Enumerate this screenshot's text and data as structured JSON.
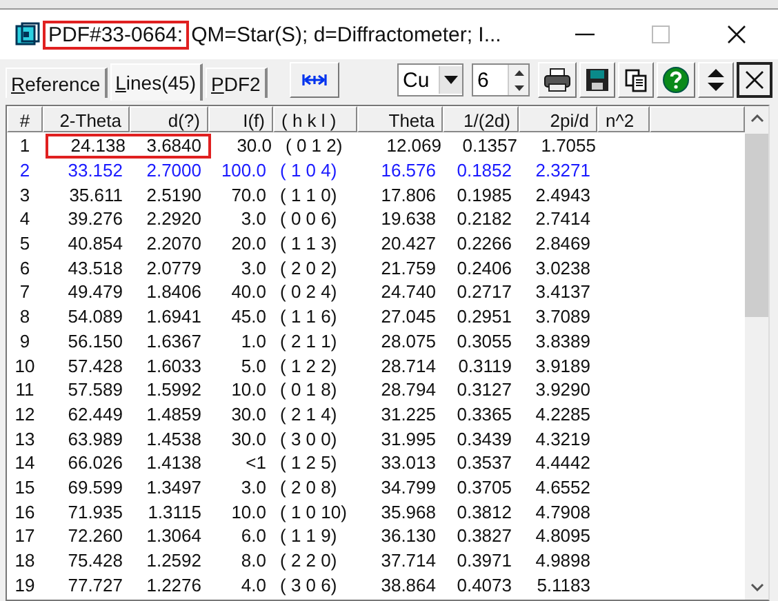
{
  "window": {
    "title_highlighted": "PDF#33-0664:",
    "title_rest": "QM=Star(S); d=Diffractometer; I..."
  },
  "tabs": [
    {
      "label": "Reference",
      "selected": false
    },
    {
      "label": "Lines(45)",
      "selected": true
    },
    {
      "label": "PDF2",
      "selected": false
    }
  ],
  "radiation": {
    "value": "Cu"
  },
  "decimals": {
    "value": "6"
  },
  "table": {
    "columns": [
      "#",
      "2-Theta",
      "d(?)",
      "I(f)",
      "( h k l )",
      "Theta",
      "1/(2d)",
      "2pi/d",
      "n^2"
    ],
    "rows": [
      {
        "cells": [
          "1",
          "24.138",
          "3.6840",
          "30.0",
          "( 0 1 2)",
          "12.069",
          "0.1357",
          "1.7055"
        ],
        "strongest": false,
        "highlighted": true
      },
      {
        "cells": [
          "2",
          "33.152",
          "2.7000",
          "100.0",
          "( 1 0 4)",
          "16.576",
          "0.1852",
          "2.3271"
        ],
        "strongest": true,
        "highlighted": false
      },
      {
        "cells": [
          "3",
          "35.611",
          "2.5190",
          "70.0",
          "( 1 1 0)",
          "17.806",
          "0.1985",
          "2.4943"
        ],
        "strongest": false,
        "highlighted": false
      },
      {
        "cells": [
          "4",
          "39.276",
          "2.2920",
          "3.0",
          "( 0 0 6)",
          "19.638",
          "0.2182",
          "2.7414"
        ],
        "strongest": false,
        "highlighted": false
      },
      {
        "cells": [
          "5",
          "40.854",
          "2.2070",
          "20.0",
          "( 1 1 3)",
          "20.427",
          "0.2266",
          "2.8469"
        ],
        "strongest": false,
        "highlighted": false
      },
      {
        "cells": [
          "6",
          "43.518",
          "2.0779",
          "3.0",
          "( 2 0 2)",
          "21.759",
          "0.2406",
          "3.0238"
        ],
        "strongest": false,
        "highlighted": false
      },
      {
        "cells": [
          "7",
          "49.479",
          "1.8406",
          "40.0",
          "( 0 2 4)",
          "24.740",
          "0.2717",
          "3.4137"
        ],
        "strongest": false,
        "highlighted": false
      },
      {
        "cells": [
          "8",
          "54.089",
          "1.6941",
          "45.0",
          "( 1 1 6)",
          "27.045",
          "0.2951",
          "3.7089"
        ],
        "strongest": false,
        "highlighted": false
      },
      {
        "cells": [
          "9",
          "56.150",
          "1.6367",
          "1.0",
          "( 2 1 1)",
          "28.075",
          "0.3055",
          "3.8389"
        ],
        "strongest": false,
        "highlighted": false
      },
      {
        "cells": [
          "10",
          "57.428",
          "1.6033",
          "5.0",
          "( 1 2 2)",
          "28.714",
          "0.3119",
          "3.9189"
        ],
        "strongest": false,
        "highlighted": false
      },
      {
        "cells": [
          "11",
          "57.589",
          "1.5992",
          "10.0",
          "( 0 1 8)",
          "28.794",
          "0.3127",
          "3.9290"
        ],
        "strongest": false,
        "highlighted": false
      },
      {
        "cells": [
          "12",
          "62.449",
          "1.4859",
          "30.0",
          "( 2 1 4)",
          "31.225",
          "0.3365",
          "4.2285"
        ],
        "strongest": false,
        "highlighted": false
      },
      {
        "cells": [
          "13",
          "63.989",
          "1.4538",
          "30.0",
          "( 3 0 0)",
          "31.995",
          "0.3439",
          "4.3219"
        ],
        "strongest": false,
        "highlighted": false
      },
      {
        "cells": [
          "14",
          "66.026",
          "1.4138",
          "<1",
          "( 1 2 5)",
          "33.013",
          "0.3537",
          "4.4442"
        ],
        "strongest": false,
        "highlighted": false
      },
      {
        "cells": [
          "15",
          "69.599",
          "1.3497",
          "3.0",
          "( 2 0 8)",
          "34.799",
          "0.3705",
          "4.6552"
        ],
        "strongest": false,
        "highlighted": false
      },
      {
        "cells": [
          "16",
          "71.935",
          "1.3115",
          "10.0",
          "( 1 0 10)",
          "35.968",
          "0.3812",
          "4.7908"
        ],
        "strongest": false,
        "highlighted": false
      },
      {
        "cells": [
          "17",
          "72.260",
          "1.3064",
          "6.0",
          "( 1 1 9)",
          "36.130",
          "0.3827",
          "4.8095"
        ],
        "strongest": false,
        "highlighted": false
      },
      {
        "cells": [
          "18",
          "75.428",
          "1.2592",
          "8.0",
          "( 2 2 0)",
          "37.714",
          "0.3971",
          "4.9898"
        ],
        "strongest": false,
        "highlighted": false
      },
      {
        "cells": [
          "19",
          "77.727",
          "1.2276",
          "4.0",
          "( 3 0 6)",
          "38.864",
          "0.4073",
          "5.1183"
        ],
        "strongest": false,
        "highlighted": false
      }
    ]
  }
}
